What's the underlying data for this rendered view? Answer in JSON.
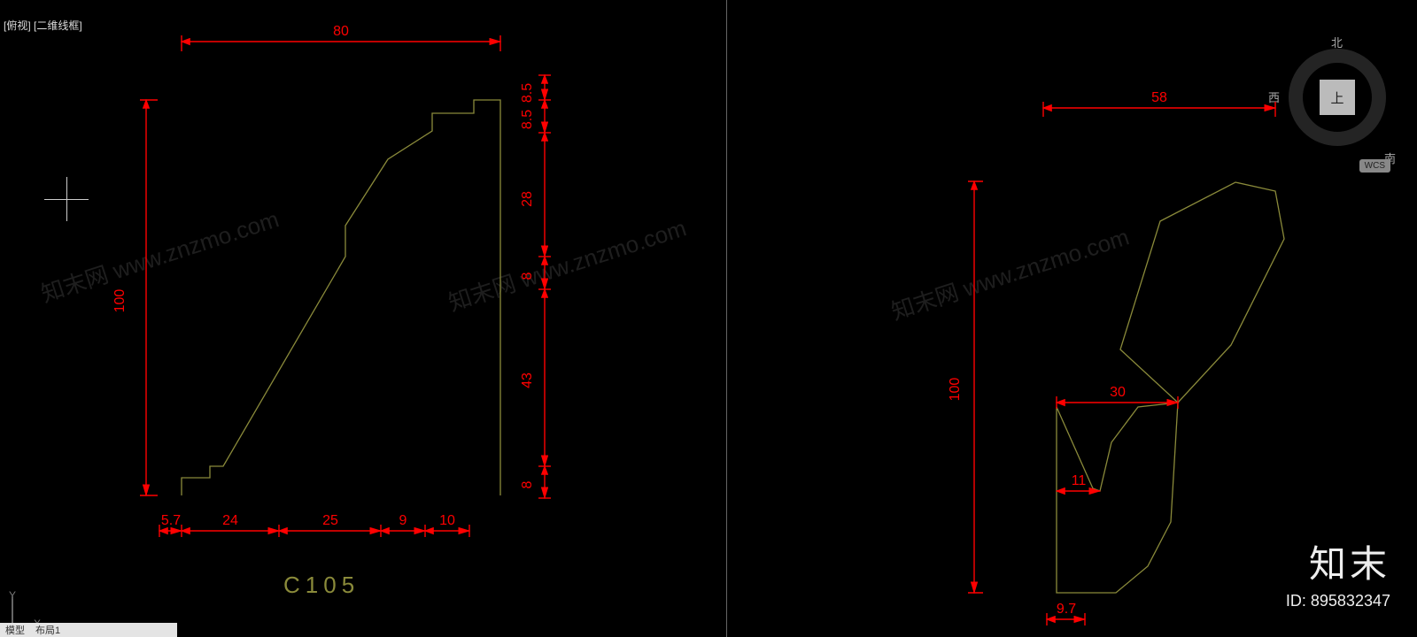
{
  "viewport": {
    "label": "[俯视] [二维线框]"
  },
  "viewcube": {
    "north": "北",
    "west": "西",
    "south": "南",
    "top": "上"
  },
  "wcs": {
    "label": "WCS"
  },
  "watermark": {
    "text": "知末网 www.znzmo.com"
  },
  "brand": {
    "name": "知末",
    "id_label": "ID: 895832347"
  },
  "axes": {
    "x": "X",
    "y": "Y"
  },
  "status": {
    "tab1": "模型",
    "tab2": "布局1"
  },
  "part_left": {
    "label": "C105",
    "dims": {
      "top": "80",
      "left": "100",
      "r1": "8.5",
      "r2": "8.5",
      "r3": "28",
      "r4": "8",
      "r5": "43",
      "r6": "8",
      "b1": "5.7",
      "b2": "24",
      "b3": "25",
      "b4": "9",
      "b5": "10"
    }
  },
  "part_right": {
    "dims": {
      "top": "58",
      "left": "100",
      "mid": "30",
      "inner": "11",
      "bottom": "9.7"
    }
  }
}
